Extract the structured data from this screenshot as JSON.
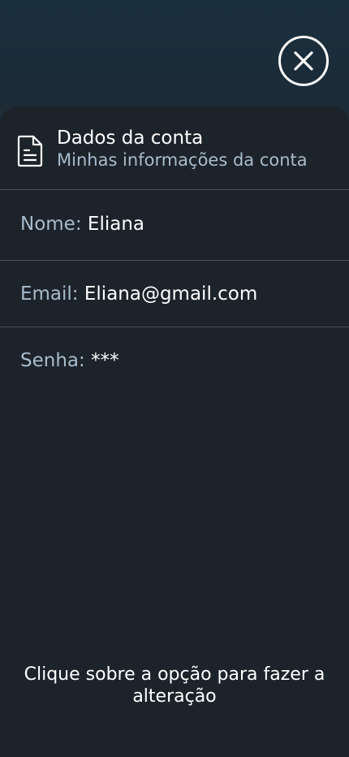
{
  "header": {
    "title": "Dados da conta",
    "subtitle": "Minhas informações da conta"
  },
  "fields": {
    "name": {
      "label": "Nome:",
      "value": "Eliana"
    },
    "email": {
      "label": "Email:",
      "value": "Eliana@gmail.com"
    },
    "password": {
      "label": "Senha:",
      "value": "***"
    }
  },
  "hint": "Clique sobre a opção para fazer a alteração",
  "icons": {
    "close": "close-icon",
    "document": "document-icon"
  },
  "colors": {
    "background": "#1d232b",
    "accent_text": "#a8bccd",
    "divider": "#4a525b"
  }
}
